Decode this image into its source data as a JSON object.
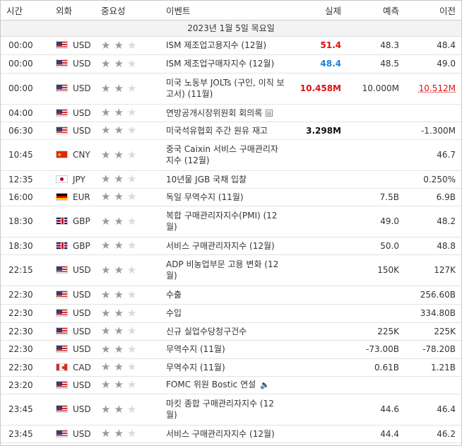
{
  "header": {
    "time": "시간",
    "currency": "외화",
    "importance": "중요성",
    "event": "이벤트",
    "actual": "실제",
    "forecast": "예측",
    "previous": "이전"
  },
  "date_label": "2023년 1월 5일 목요일",
  "rows": [
    {
      "time": "00:00",
      "flag": "usa",
      "cur": "USD",
      "stars": 2,
      "event": "ISM 제조업고용지수 (12월)",
      "actual": "51.4",
      "actual_color": "red",
      "forecast": "48.3",
      "previous": "48.4"
    },
    {
      "time": "00:00",
      "flag": "usa",
      "cur": "USD",
      "stars": 2,
      "event": "ISM 제조업구매자지수 (12월)",
      "actual": "48.4",
      "actual_color": "blue",
      "forecast": "48.5",
      "previous": "49.0"
    },
    {
      "time": "00:00",
      "flag": "usa",
      "cur": "USD",
      "stars": 2,
      "event": "미국 노동부 JOLTs (구인, 이직 보고서) (11월)",
      "actual": "10.458M",
      "actual_color": "red",
      "forecast": "10.000M",
      "previous": "10.512M",
      "previous_style": "revised"
    },
    {
      "time": "04:00",
      "flag": "usa",
      "cur": "USD",
      "stars": 2,
      "event": "연방공개시장위원회 회의록",
      "icon": "document-icon",
      "actual": "",
      "forecast": "",
      "previous": ""
    },
    {
      "time": "06:30",
      "flag": "usa",
      "cur": "USD",
      "stars": 2,
      "event": "미국석유협회 주간 원유 재고",
      "actual": "3.298M",
      "actual_color": "black",
      "forecast": "",
      "previous": "-1.300M"
    },
    {
      "time": "10:45",
      "flag": "chn",
      "cur": "CNY",
      "stars": 2,
      "event": "중국 Caixin 서비스 구매관리자지수 (12월)",
      "actual": "",
      "forecast": "",
      "previous": "46.7"
    },
    {
      "time": "12:35",
      "flag": "jpn",
      "cur": "JPY",
      "stars": 2,
      "event": "10년물 JGB 국채 입찰",
      "actual": "",
      "forecast": "",
      "previous": "0.250%"
    },
    {
      "time": "16:00",
      "flag": "deu",
      "cur": "EUR",
      "stars": 2,
      "event": "독일 무역수지 (11월)",
      "actual": "",
      "forecast": "7.5B",
      "previous": "6.9B"
    },
    {
      "time": "18:30",
      "flag": "gbr",
      "cur": "GBP",
      "stars": 2,
      "event": "복합 구매관리자지수(PMI) (12월)",
      "actual": "",
      "forecast": "49.0",
      "previous": "48.2"
    },
    {
      "time": "18:30",
      "flag": "gbr",
      "cur": "GBP",
      "stars": 2,
      "event": "서비스 구매관리자지수 (12월)",
      "actual": "",
      "forecast": "50.0",
      "previous": "48.8"
    },
    {
      "time": "22:15",
      "flag": "usa",
      "cur": "USD",
      "stars": 2,
      "event": "ADP 비농업부문 고용 변화 (12월)",
      "actual": "",
      "forecast": "150K",
      "previous": "127K"
    },
    {
      "time": "22:30",
      "flag": "usa",
      "cur": "USD",
      "stars": 2,
      "event": "수출",
      "actual": "",
      "forecast": "",
      "previous": "256.60B"
    },
    {
      "time": "22:30",
      "flag": "usa",
      "cur": "USD",
      "stars": 2,
      "event": "수입",
      "actual": "",
      "forecast": "",
      "previous": "334.80B"
    },
    {
      "time": "22:30",
      "flag": "usa",
      "cur": "USD",
      "stars": 2,
      "event": "신규 실업수당청구건수",
      "actual": "",
      "forecast": "225K",
      "previous": "225K"
    },
    {
      "time": "22:30",
      "flag": "usa",
      "cur": "USD",
      "stars": 2,
      "event": "무역수지 (11월)",
      "actual": "",
      "forecast": "-73.00B",
      "previous": "-78.20B"
    },
    {
      "time": "22:30",
      "flag": "can",
      "cur": "CAD",
      "stars": 2,
      "event": "무역수지 (11월)",
      "actual": "",
      "forecast": "0.61B",
      "previous": "1.21B"
    },
    {
      "time": "23:20",
      "flag": "usa",
      "cur": "USD",
      "stars": 2,
      "event": "FOMC 위원 Bostic 연설",
      "icon": "speaker-icon",
      "actual": "",
      "forecast": "",
      "previous": ""
    },
    {
      "time": "23:45",
      "flag": "usa",
      "cur": "USD",
      "stars": 2,
      "event": "마킷 종합 구매관리자지수 (12월)",
      "actual": "",
      "forecast": "44.6",
      "previous": "46.4"
    },
    {
      "time": "23:45",
      "flag": "usa",
      "cur": "USD",
      "stars": 2,
      "event": "서비스 구매관리자지수 (12월)",
      "actual": "",
      "forecast": "44.4",
      "previous": "46.2"
    }
  ]
}
